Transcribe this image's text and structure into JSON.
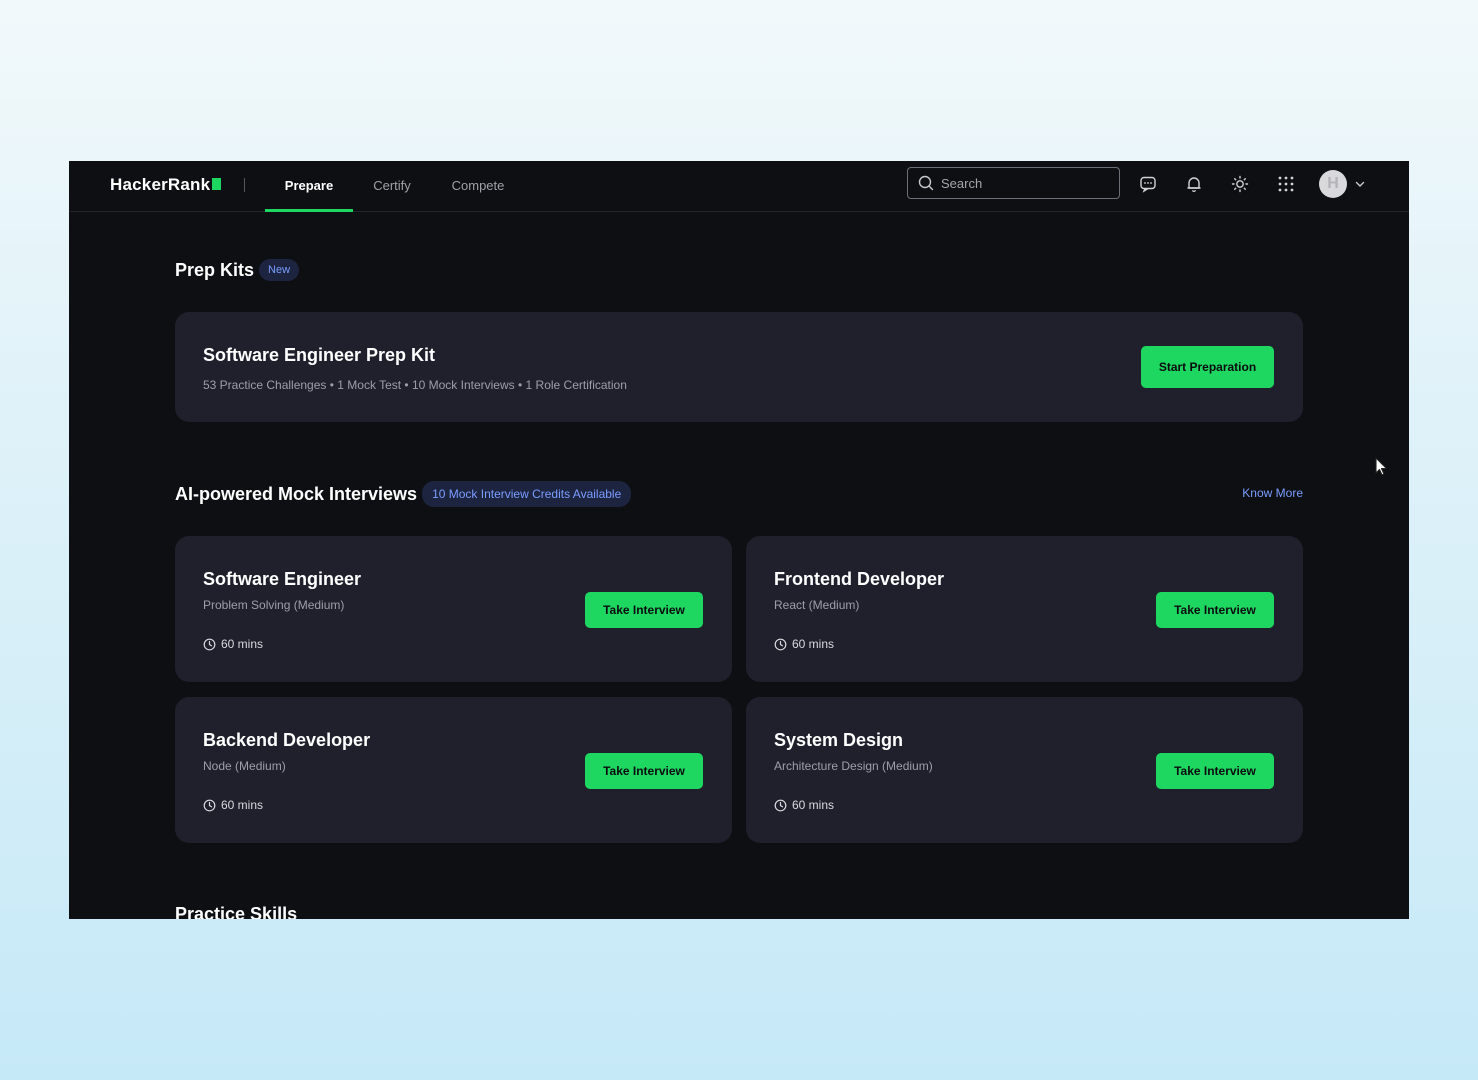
{
  "header": {
    "brand": "HackerRank",
    "tabs": [
      {
        "label": "Prepare",
        "active": true
      },
      {
        "label": "Certify",
        "active": false
      },
      {
        "label": "Compete",
        "active": false
      }
    ],
    "search_placeholder": "Search",
    "icons": [
      "search-icon",
      "chat-icon",
      "bell-icon",
      "sun-icon",
      "apps-grid-icon",
      "chevron-down-icon"
    ],
    "avatar_initial": "H"
  },
  "prep_kits": {
    "title": "Prep Kits",
    "badge": "New",
    "kit": {
      "title": "Software Engineer Prep Kit",
      "subtitle": "53 Practice Challenges • 1 Mock Test • 10 Mock Interviews • 1 Role Certification",
      "cta": "Start Preparation"
    }
  },
  "mock_interviews": {
    "title": "AI-powered Mock Interviews",
    "credits_badge": "10 Mock Interview Credits Available",
    "know_more": "Know More",
    "cards": [
      {
        "title": "Software Engineer",
        "subtitle": "Problem Solving (Medium)",
        "duration": "60 mins",
        "cta": "Take Interview"
      },
      {
        "title": "Frontend Developer",
        "subtitle": "React (Medium)",
        "duration": "60 mins",
        "cta": "Take Interview"
      },
      {
        "title": "Backend Developer",
        "subtitle": "Node (Medium)",
        "duration": "60 mins",
        "cta": "Take Interview"
      },
      {
        "title": "System Design",
        "subtitle": "Architecture Design (Medium)",
        "duration": "60 mins",
        "cta": "Take Interview"
      }
    ]
  },
  "practice_skills": {
    "title": "Practice Skills"
  },
  "colors": {
    "accent": "#1ed760",
    "background": "#0e0f12",
    "card": "#1f202c",
    "link": "#7b9dff"
  }
}
